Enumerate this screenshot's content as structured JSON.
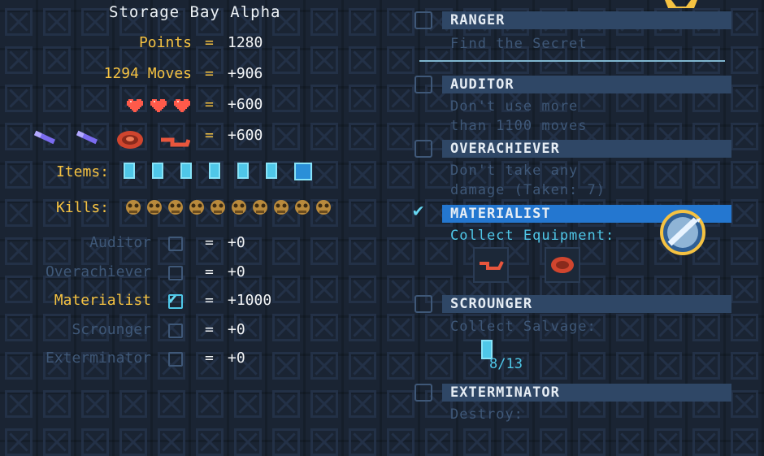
{
  "summary": {
    "title": "Storage Bay Alpha",
    "points_label": "Points",
    "points_eq": "=",
    "points_value": "1280",
    "moves_label": "1294 Moves",
    "moves_eq": "=",
    "moves_value": "+906",
    "hearts_eq": "=",
    "hearts_value": "+600",
    "hearts_count": 3,
    "equipment_eq": "=",
    "equipment_value": "+600",
    "items_label": "Items:",
    "items_count": 7,
    "kills_label": "Kills:",
    "kills_count": 10
  },
  "bonuses": [
    {
      "label": "Auditor",
      "eq": "=",
      "value": "+0",
      "checked": false
    },
    {
      "label": "Overachiever",
      "eq": "=",
      "value": "+0",
      "checked": false
    },
    {
      "label": "Materialist",
      "eq": "=",
      "value": "+1000",
      "checked": true
    },
    {
      "label": "Scrounger",
      "eq": "=",
      "value": "+0",
      "checked": false
    },
    {
      "label": "Exterminator",
      "eq": "=",
      "value": "+0",
      "checked": false
    }
  ],
  "achievements": [
    {
      "name": "RANGER",
      "desc1": "Find the Secret",
      "desc2": "",
      "checked": false
    },
    {
      "name": "AUDITOR",
      "desc1": "Don't use more",
      "desc2": "than 1100 moves",
      "checked": false
    },
    {
      "name": "OVERACHIEVER",
      "desc1": "Don't take any",
      "desc2": "damage (Taken: 7)",
      "checked": false
    },
    {
      "name": "MATERIALIST",
      "desc1": "Collect Equipment:",
      "desc2": "",
      "checked": true
    },
    {
      "name": "SCROUNGER",
      "desc1": "Collect Salvage:",
      "desc2": "",
      "checked": false
    },
    {
      "name": "EXTERMINATOR",
      "desc1": "Destroy:",
      "desc2": "",
      "checked": false
    }
  ],
  "scrounger_progress": "8/13",
  "colors": {
    "accent_gold": "#f5c242",
    "accent_cyan": "#4fc7e8",
    "dim": "#3f5878",
    "active_bar": "#2477d0",
    "background": "#1a2433"
  }
}
